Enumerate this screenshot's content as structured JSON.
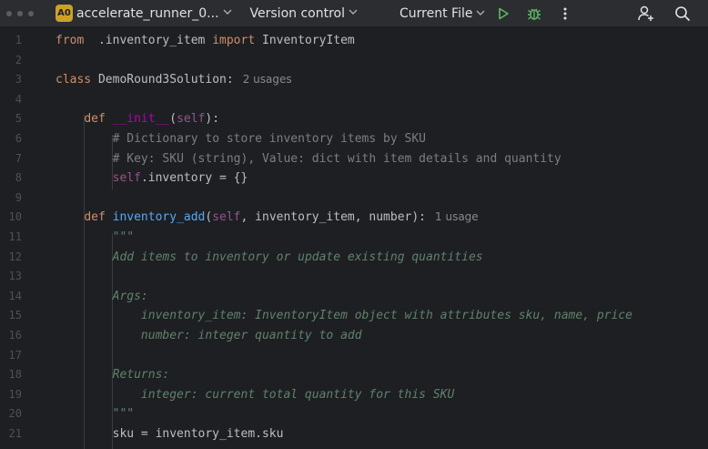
{
  "toolbar": {
    "project_badge": "A0",
    "project_name": "accelerate_runner_0...",
    "vcs_label": "Version control",
    "run_config_label": "Current File",
    "run_icon": "play-icon",
    "debug_icon": "bug-icon",
    "more_icon": "vertical-dots-icon",
    "add_user_icon": "add-user-icon",
    "search_icon": "search-icon"
  },
  "editor": {
    "lines": [
      {
        "n": "1",
        "parts": [
          [
            "kw",
            "from"
          ],
          [
            "",
            "  .inventory_item "
          ],
          [
            "kw",
            "import"
          ],
          [
            "",
            " InventoryItem"
          ]
        ]
      },
      {
        "n": "2",
        "parts": []
      },
      {
        "n": "3",
        "parts": [
          [
            "kw",
            "class"
          ],
          [
            "",
            " DemoRound3Solution:"
          ]
        ],
        "hint": "2 usages"
      },
      {
        "n": "4",
        "parts": []
      },
      {
        "n": "5",
        "parts": [
          [
            "",
            "    "
          ],
          [
            "kw",
            "def"
          ],
          [
            "",
            " "
          ],
          [
            "magic",
            "__init__"
          ],
          [
            "",
            "("
          ],
          [
            "selfc",
            "self"
          ],
          [
            "",
            "):"
          ]
        ]
      },
      {
        "n": "6",
        "parts": [
          [
            "",
            "        "
          ],
          [
            "cm",
            "# Dictionary to store inventory items by SKU"
          ]
        ]
      },
      {
        "n": "7",
        "parts": [
          [
            "",
            "        "
          ],
          [
            "cm",
            "# Key: SKU (string), Value: dict with item details and quantity"
          ]
        ]
      },
      {
        "n": "8",
        "parts": [
          [
            "",
            "        "
          ],
          [
            "selfc",
            "self"
          ],
          [
            "",
            ".inventory = {}"
          ]
        ]
      },
      {
        "n": "9",
        "parts": []
      },
      {
        "n": "10",
        "parts": [
          [
            "",
            "    "
          ],
          [
            "kw",
            "def"
          ],
          [
            "",
            " "
          ],
          [
            "fn",
            "inventory_add"
          ],
          [
            "",
            "("
          ],
          [
            "selfc",
            "self"
          ],
          [
            "",
            ", inventory_item, number):"
          ]
        ],
        "hint": "1 usage"
      },
      {
        "n": "11",
        "parts": [
          [
            "",
            "        "
          ],
          [
            "doc",
            "\"\"\""
          ]
        ]
      },
      {
        "n": "12",
        "parts": [
          [
            "",
            "        "
          ],
          [
            "doc",
            "Add items to inventory or update existing quantities"
          ]
        ]
      },
      {
        "n": "13",
        "parts": []
      },
      {
        "n": "14",
        "parts": [
          [
            "",
            "        "
          ],
          [
            "doc",
            "Args:"
          ]
        ]
      },
      {
        "n": "15",
        "parts": [
          [
            "",
            "            "
          ],
          [
            "doc",
            "inventory_item: InventoryItem object with attributes sku, name, price"
          ]
        ]
      },
      {
        "n": "16",
        "parts": [
          [
            "",
            "            "
          ],
          [
            "doc",
            "number: integer quantity to add"
          ]
        ]
      },
      {
        "n": "17",
        "parts": []
      },
      {
        "n": "18",
        "parts": [
          [
            "",
            "        "
          ],
          [
            "doc",
            "Returns:"
          ]
        ]
      },
      {
        "n": "19",
        "parts": [
          [
            "",
            "            "
          ],
          [
            "doc",
            "integer: current total quantity for this SKU"
          ]
        ]
      },
      {
        "n": "20",
        "parts": [
          [
            "",
            "        "
          ],
          [
            "doc",
            "\"\"\""
          ]
        ]
      },
      {
        "n": "21",
        "parts": [
          [
            "",
            "        sku = inventory_item.sku"
          ]
        ]
      }
    ]
  }
}
